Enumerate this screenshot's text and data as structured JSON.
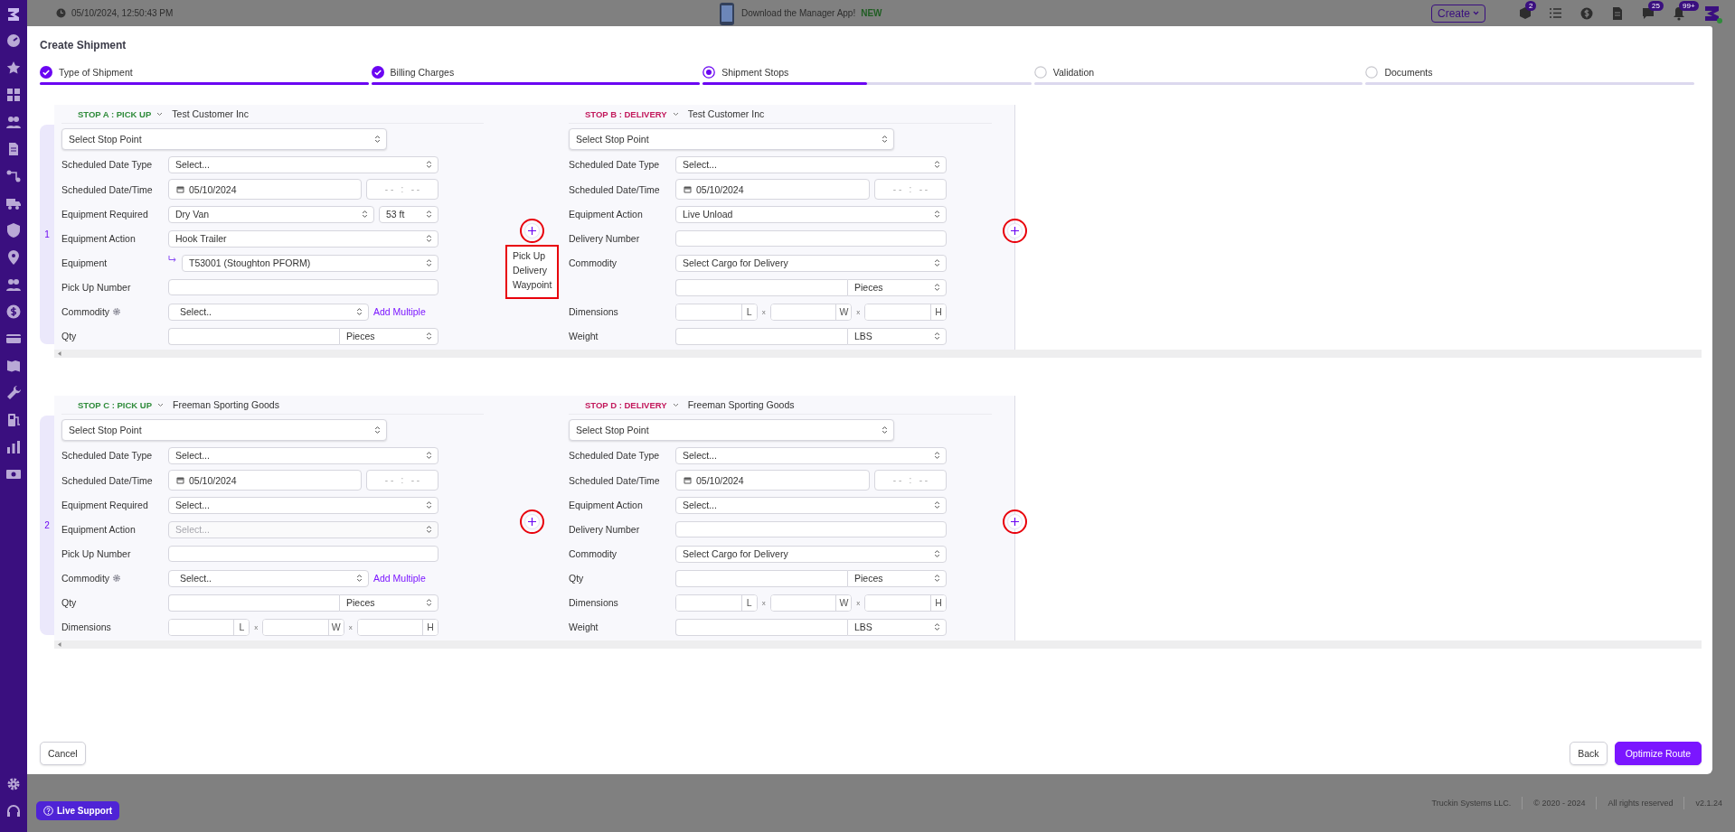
{
  "top_bar": {
    "datetime": "05/10/2024, 12:50:43 PM",
    "promo": "Download the Manager App!",
    "promo_badge": "NEW",
    "create_button": "Create",
    "tools": [
      {
        "kind": "box",
        "badge": "2"
      },
      {
        "kind": "list"
      },
      {
        "kind": "dollar"
      },
      {
        "kind": "document"
      },
      {
        "kind": "chat",
        "badge": "25"
      },
      {
        "kind": "bell",
        "badge": "99+"
      }
    ]
  },
  "modal": {
    "title": "Create Shipment",
    "steps": [
      {
        "label": "Type of Shipment",
        "completed": true,
        "selected": false,
        "level": 1
      },
      {
        "label": "Billing Charges",
        "completed": true,
        "selected": false,
        "level": 1
      },
      {
        "label": "Shipment Stops",
        "completed": false,
        "selected": true,
        "level": 0.5
      },
      {
        "label": "Validation",
        "completed": false,
        "selected": false
      },
      {
        "label": "Documents",
        "completed": false,
        "selected": false
      }
    ],
    "routes": [
      {
        "number": "1",
        "insert_buttons": [
          {
            "highlighted": true,
            "menu": {
              "highlighted": true,
              "items": [
                "Pick Up",
                "Delivery",
                "Waypoint"
              ]
            }
          },
          {
            "highlighted": true
          }
        ],
        "stops": [
          {
            "label": "STOP A : PICK UP",
            "color": "#2e8b3a",
            "customer": "Test Customer Inc",
            "fields": [
              {
                "kind": "stop_point",
                "value": "Select Stop Point"
              },
              {
                "kind": "select",
                "label": "Scheduled Date Type",
                "value": "Select...",
                "disabled": false
              },
              {
                "kind": "date",
                "label": "Scheduled Date/Time",
                "date": "05/10/2024",
                "time": "- -   :   - -"
              },
              {
                "kind": "select_pair",
                "label": "Equipment Required",
                "value": "Dry Van",
                "value_2": "53 ft"
              },
              {
                "kind": "select",
                "label": "Equipment Action",
                "value": "Hook Trailer",
                "disabled": false
              },
              {
                "kind": "equipment",
                "label": "Equipment",
                "value": "T53001 (Stoughton PFORM)"
              },
              {
                "kind": "text",
                "label": "Pick Up Number"
              },
              {
                "kind": "commodity",
                "label": "Commodity",
                "value": "Select..",
                "link": "Add Multiple"
              },
              {
                "kind": "quantity",
                "label": "Qty",
                "unit": "Pieces"
              }
            ]
          },
          {
            "label": "STOP B : DELIVERY",
            "color": "#c2185b",
            "customer": "Test Customer Inc",
            "fields": [
              {
                "kind": "stop_point",
                "value": "Select Stop Point"
              },
              {
                "kind": "select",
                "label": "Scheduled Date Type",
                "value": "Select...",
                "disabled": false
              },
              {
                "kind": "date",
                "label": "Scheduled Date/Time",
                "date": "05/10/2024",
                "time": "- -   :   - -"
              },
              {
                "kind": "select",
                "label": "Equipment Action",
                "value": "Live Unload",
                "disabled": false
              },
              {
                "kind": "text",
                "label": "Delivery Number"
              },
              {
                "kind": "select",
                "label": "Commodity",
                "value": "Select Cargo for Delivery",
                "disabled": false
              },
              {
                "kind": "quantity",
                "unit": "Pieces"
              },
              {
                "kind": "dimensions",
                "label": "Dimensions",
                "units": [
                  "L",
                  "W",
                  "H"
                ],
                "separators": [
                  "x",
                  "x"
                ]
              },
              {
                "kind": "quantity",
                "label": "Weight",
                "unit": "LBS"
              }
            ]
          }
        ]
      },
      {
        "number": "2",
        "insert_buttons": [
          {
            "highlighted": true
          },
          {
            "highlighted": true
          }
        ],
        "stops": [
          {
            "label": "STOP C : PICK UP",
            "color": "#2e8b3a",
            "customer": "Freeman Sporting Goods",
            "fields": [
              {
                "kind": "stop_point",
                "value": "Select Stop Point"
              },
              {
                "kind": "select",
                "label": "Scheduled Date Type",
                "value": "Select...",
                "disabled": false
              },
              {
                "kind": "date",
                "label": "Scheduled Date/Time",
                "date": "05/10/2024",
                "time": "- -   :   - -"
              },
              {
                "kind": "select",
                "label": "Equipment Required",
                "value": "Select...",
                "disabled": false
              },
              {
                "kind": "select",
                "label": "Equipment Action",
                "placeholder": "Select...",
                "disabled": true
              },
              {
                "kind": "text",
                "label": "Pick Up Number"
              },
              {
                "kind": "commodity",
                "label": "Commodity",
                "value": "Select..",
                "link": "Add Multiple"
              },
              {
                "kind": "quantity",
                "label": "Qty",
                "unit": "Pieces"
              },
              {
                "kind": "dimensions",
                "label": "Dimensions",
                "units": [
                  "L",
                  "W",
                  "H"
                ],
                "separators": [
                  "x",
                  "x"
                ]
              }
            ]
          },
          {
            "label": "STOP D : DELIVERY",
            "color": "#c2185b",
            "customer": "Freeman Sporting Goods",
            "fields": [
              {
                "kind": "stop_point",
                "value": "Select Stop Point"
              },
              {
                "kind": "select",
                "label": "Scheduled Date Type",
                "value": "Select...",
                "disabled": false
              },
              {
                "kind": "date",
                "label": "Scheduled Date/Time",
                "date": "05/10/2024",
                "time": "- -   :   - -"
              },
              {
                "kind": "select",
                "label": "Equipment Action",
                "value": "Select...",
                "disabled": false
              },
              {
                "kind": "text",
                "label": "Delivery Number"
              },
              {
                "kind": "select",
                "label": "Commodity",
                "value": "Select Cargo for Delivery",
                "disabled": false
              },
              {
                "kind": "quantity",
                "label": "Qty",
                "unit": "Pieces"
              },
              {
                "kind": "dimensions",
                "label": "Dimensions",
                "units": [
                  "L",
                  "W",
                  "H"
                ],
                "separators": [
                  "x",
                  "x"
                ]
              },
              {
                "kind": "quantity",
                "label": "Weight",
                "unit": "LBS"
              }
            ]
          }
        ]
      }
    ],
    "cancel_button": "Cancel",
    "back_button": "Back",
    "primary_button": "Optimize Route"
  },
  "footer": [
    "Truckin Systems LLC.",
    "© 2020 - 2024",
    "All rights reserved",
    "v2.1.24"
  ],
  "live_support": "Live Support"
}
